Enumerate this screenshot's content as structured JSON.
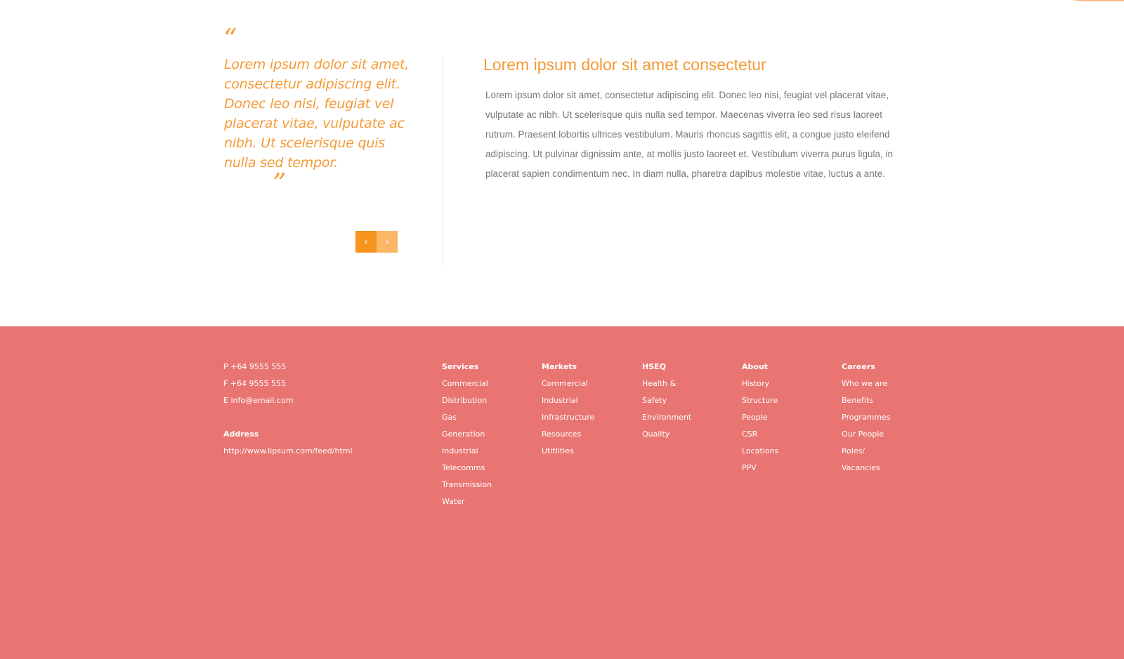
{
  "testimonial": {
    "open_quote": "“",
    "close_quote": "”",
    "text": "Lorem ipsum dolor sit amet, consectetur adipiscing elit. Donec leo nisi, feugiat vel placerat vitae, vulputate ac nibh. Ut scelerisque quis nulla sed tempor.",
    "prev_icon": "‹",
    "next_icon": "›"
  },
  "article": {
    "title": "Lorem ipsum dolor sit amet consectetur",
    "body": "Lorem ipsum dolor sit amet, consectetur adipiscing elit. Donec leo nisi, feugiat vel placerat vitae, vulputate ac nibh. Ut scelerisque quis nulla sed tempor. Maecenas viverra leo sed risus laoreet rutrum. Praesent lobortis ultrices vestibulum. Mauris rhoncus sagittis elit, a congue justo eleifend adipiscing. Ut pulvinar dignissim ante, at mollis justo laoreet et. Vestibulum viverra purus ligula, in placerat sapien condimentum nec. In diam nulla, pharetra dapibus molestie vitae, luctus a ante."
  },
  "footer": {
    "phone": "P +64 9555 555",
    "fax": "F +64 9555 555",
    "email": "E info@email.com",
    "address_heading": "Address",
    "address_url": "http://www.lipsum.com/feed/html",
    "columns": {
      "services": {
        "heading": "Services",
        "items": [
          "Commercial",
          "Distribution",
          "Gas",
          "Generation",
          "Industrial",
          "Telecomms",
          "Transmission",
          "Water"
        ]
      },
      "markets": {
        "heading": "Markets",
        "items": [
          "Commercial",
          "Industrial",
          "Infrastructure",
          "Resources",
          "Utitlities"
        ]
      },
      "hseq": {
        "heading": "HSEQ",
        "items": [
          "Health &",
          "Safety",
          "Environment",
          "Quality"
        ]
      },
      "about": {
        "heading": "About",
        "items": [
          "History",
          "Structure",
          "People",
          "CSR",
          "Locations",
          "PPV"
        ]
      },
      "careers": {
        "heading": "Careers",
        "items": [
          "Who we are",
          "Benefits",
          "Programmes",
          "Our People",
          "Roles/",
          "Vacancies"
        ]
      }
    }
  },
  "colors": {
    "accent": "#f59a36",
    "button_primary": "#f7941d",
    "button_secondary": "#fbb766",
    "footer_bg": "#e87572"
  }
}
